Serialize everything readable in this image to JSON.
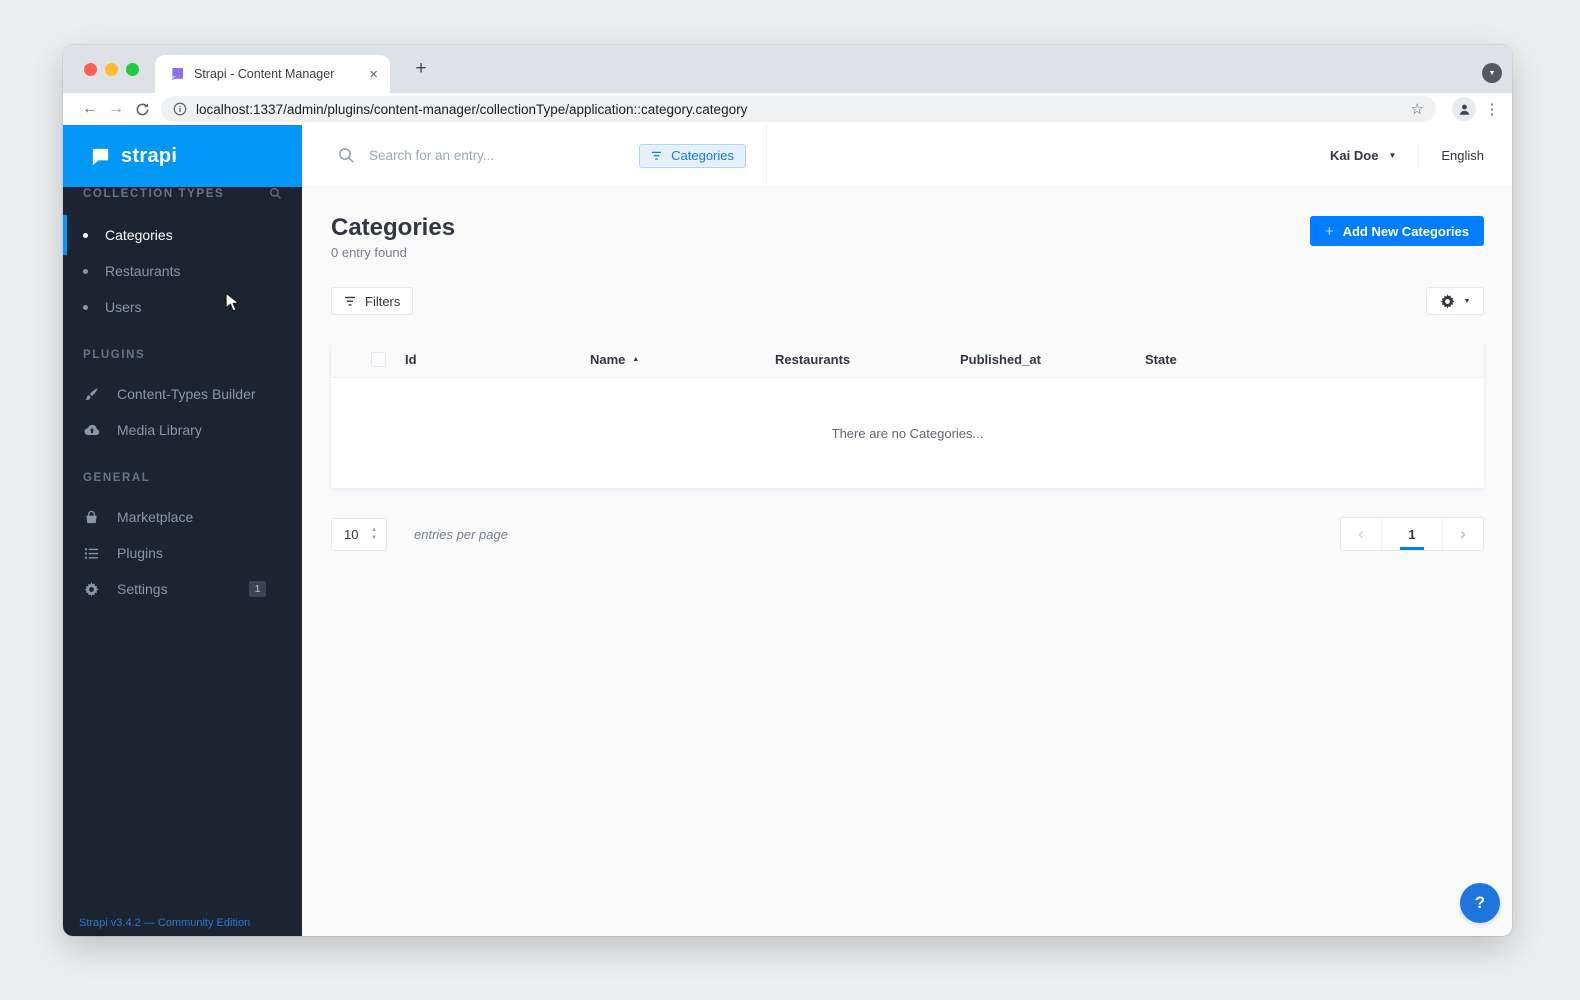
{
  "browser": {
    "tab_title": "Strapi - Content Manager",
    "url": "localhost:1337/admin/plugins/content-manager/collectionType/application::category.category"
  },
  "icons": {
    "plus": "+",
    "close": "×",
    "back_arrow": "←",
    "forward_arrow": "→",
    "menu_dots": "⋮",
    "star": "☆",
    "caret_down": "▼",
    "sort_asc": "▲",
    "chevron_left": "‹",
    "chevron_right": "›",
    "stepper_up": "▲",
    "stepper_down": "▼",
    "gear": "⚙",
    "cloud": "☁"
  },
  "sidebar": {
    "logo_text": "strapi",
    "sections": [
      {
        "label": "COLLECTION TYPES",
        "items": [
          {
            "label": "Categories"
          },
          {
            "label": "Restaurants"
          },
          {
            "label": "Users"
          }
        ]
      },
      {
        "label": "PLUGINS",
        "items": [
          {
            "label": "Content-Types Builder"
          },
          {
            "label": "Media Library"
          }
        ]
      },
      {
        "label": "GENERAL",
        "items": [
          {
            "label": "Marketplace"
          },
          {
            "label": "Plugins"
          },
          {
            "label": "Settings",
            "badge": "1"
          }
        ]
      }
    ],
    "footer": "Strapi v3.4.2 — Community Edition"
  },
  "topbar": {
    "search_placeholder": "Search for an entry...",
    "filter_chip": "Categories",
    "user_name": "Kai Doe",
    "language": "English"
  },
  "main": {
    "title": "Categories",
    "subtitle": "0 entry found",
    "add_button": "Add New Categories",
    "filters_button": "Filters",
    "table": {
      "columns": [
        "Id",
        "Name",
        "Restaurants",
        "Published_at",
        "State"
      ],
      "sorted_column": "Name",
      "empty_message": "There are no Categories..."
    },
    "pagination": {
      "per_page": "10",
      "per_page_label": "entries per page",
      "current_page": "1"
    }
  },
  "help_button": "?",
  "colors": {
    "accent": "#007eff",
    "header_blue": "#0097f7",
    "sidebar_bg": "#1c2431"
  }
}
